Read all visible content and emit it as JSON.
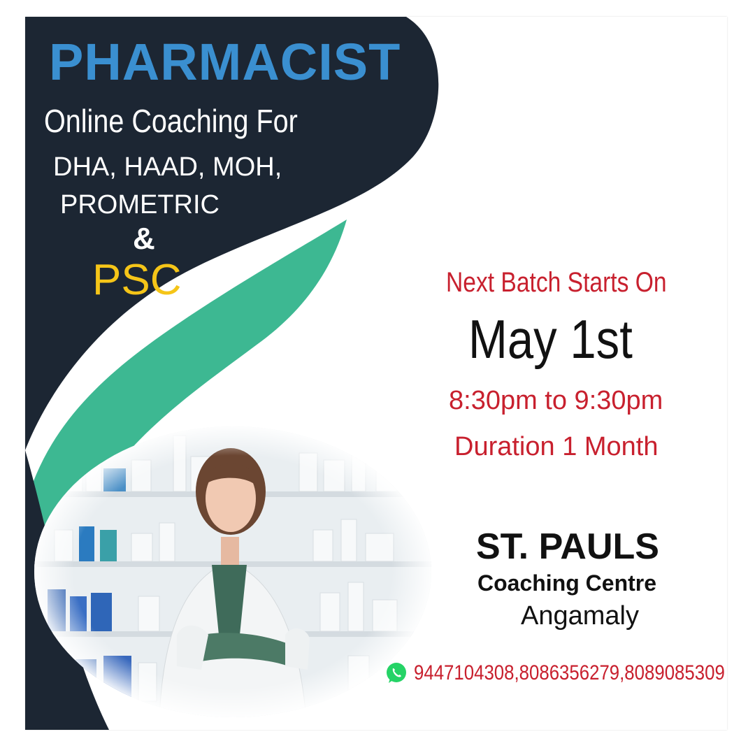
{
  "colors": {
    "dark": "#1c2633",
    "teal": "#3db892",
    "title_blue": "#3a8fd0",
    "psc_yellow": "#f5c518",
    "accent_red": "#c8202e",
    "whatsapp_green": "#25d366"
  },
  "headline": {
    "title": "PHARMACIST",
    "subtitle": "Online Coaching For",
    "exams_line1": "DHA, HAAD, MOH,",
    "exams_line2": "PROMETRIC",
    "ampersand": "&",
    "psc": "PSC"
  },
  "batch": {
    "heading": "Next Batch Starts On",
    "date": "May 1st",
    "time": "8:30pm to 9:30pm",
    "duration": "Duration 1 Month"
  },
  "organization": {
    "name": "ST. PAULS",
    "line2": "Coaching Centre",
    "location": "Angamaly"
  },
  "contact": {
    "icon": "whatsapp-icon",
    "phones": "9447104308,8086356279,8089085309"
  },
  "image": {
    "subject": "pharmacist-photo"
  }
}
